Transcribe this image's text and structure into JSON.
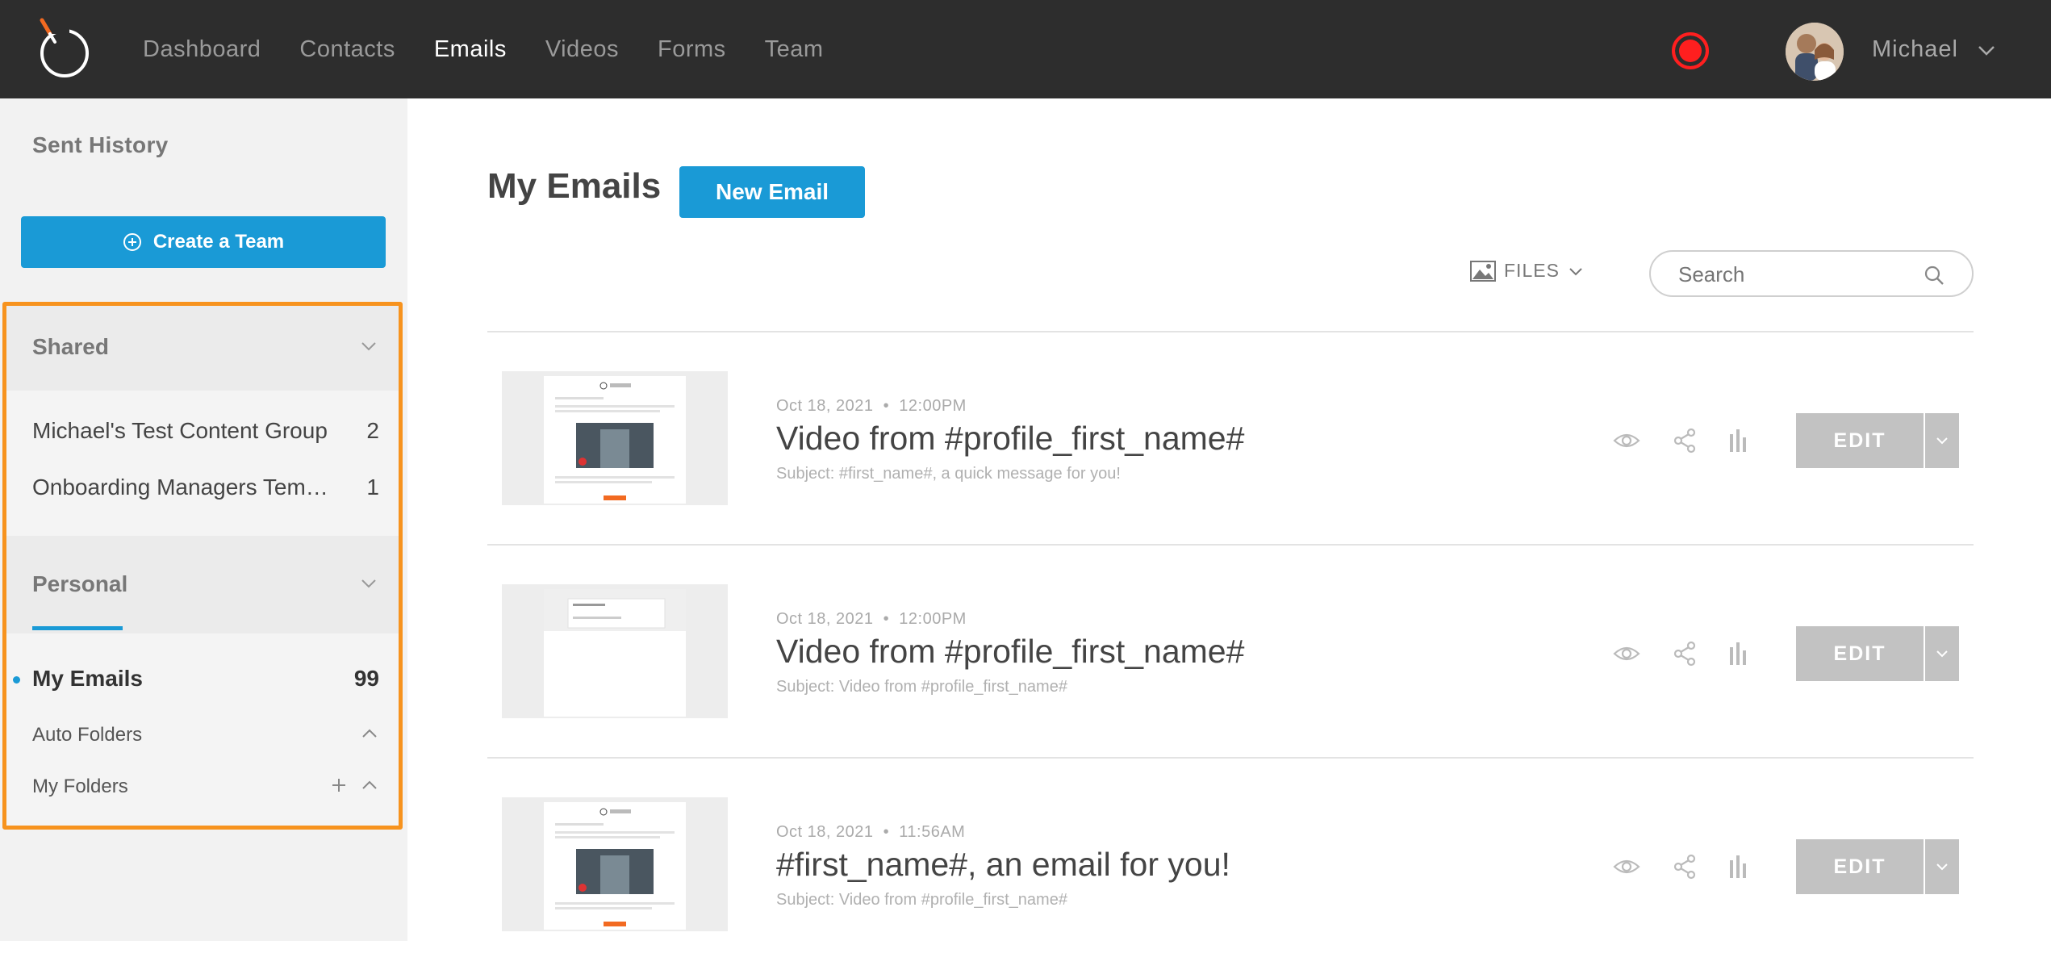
{
  "nav": {
    "items": [
      {
        "label": "Dashboard",
        "active": false
      },
      {
        "label": "Contacts",
        "active": false
      },
      {
        "label": "Emails",
        "active": true
      },
      {
        "label": "Videos",
        "active": false
      },
      {
        "label": "Forms",
        "active": false
      },
      {
        "label": "Team",
        "active": false
      }
    ],
    "user_name": "Michael"
  },
  "sidebar": {
    "sent_history": "Sent History",
    "create_team_label": "Create a Team",
    "shared": {
      "title": "Shared",
      "groups": [
        {
          "name": "Michael's Test Content Group",
          "count": "2"
        },
        {
          "name": "Onboarding Managers Tem…",
          "count": "1"
        }
      ]
    },
    "personal": {
      "title": "Personal",
      "my_emails": {
        "label": "My Emails",
        "count": "99"
      },
      "auto_folders": "Auto Folders",
      "my_folders": "My Folders"
    }
  },
  "main": {
    "title": "My Emails",
    "new_email_label": "New Email",
    "files_label": "FILES",
    "search_placeholder": "Search",
    "edit_label": "EDIT",
    "emails": [
      {
        "date": "Oct 18, 2021",
        "time": "12:00PM",
        "title": "Video from #profile_first_name#",
        "subject": "Subject: #first_name#, a quick message for you!"
      },
      {
        "date": "Oct 18, 2021",
        "time": "12:00PM",
        "title": "Video from #profile_first_name#",
        "subject": "Subject: Video from #profile_first_name#"
      },
      {
        "date": "Oct 18, 2021",
        "time": "11:56AM",
        "title": "#first_name#, an email for you!",
        "subject": "Subject: Video from #profile_first_name#"
      }
    ]
  },
  "colors": {
    "topbar": "#2d2d2d",
    "accent": "#1a9ad6",
    "highlight": "#f7931e",
    "record": "#ff1f1f"
  }
}
